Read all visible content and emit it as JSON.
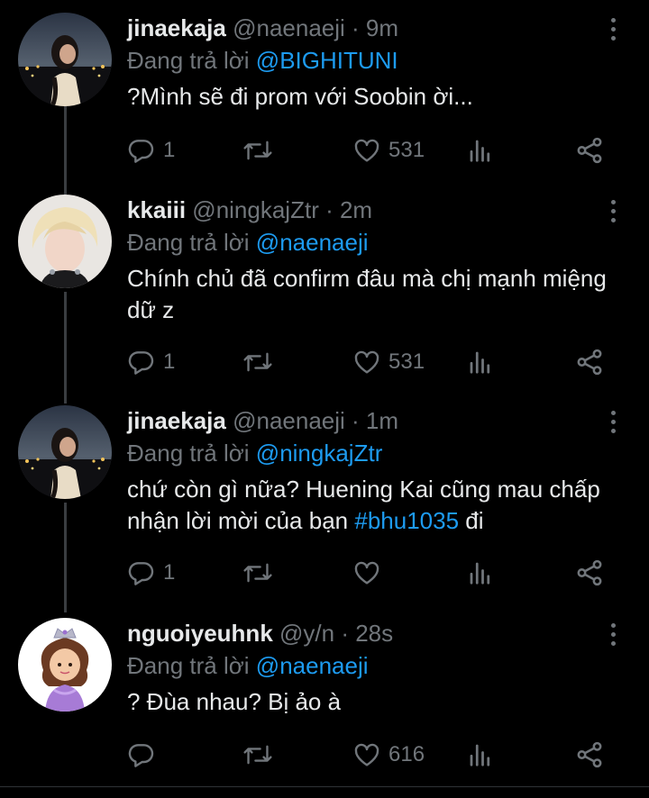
{
  "tweets": [
    {
      "name": "jinaekaja",
      "handle": "@naenaeji",
      "time": "· 9m",
      "reply_prefix": "Đang trả lời",
      "reply_to": "@BIGHITUNI",
      "text_parts": [
        "?Mình sẽ đi prom với Soobin ời...",
        "",
        ""
      ],
      "replies": "1",
      "likes": "531"
    },
    {
      "name": "kkaiii",
      "handle": "@ningkajZtr",
      "time": "· 2m",
      "reply_prefix": "Đang trả lời",
      "reply_to": "@naenaeji",
      "text_parts": [
        "Chính chủ đã confirm đâu mà chị mạnh miệng dữ z",
        "",
        ""
      ],
      "replies": "1",
      "likes": "531"
    },
    {
      "name": "jinaekaja",
      "handle": "@naenaeji",
      "time": "· 1m",
      "reply_prefix": "Đang trả lời",
      "reply_to": "@ningkajZtr",
      "text_parts": [
        "chứ còn gì nữa? Huening Kai cũng mau chấp nhận lời mời của bạn ",
        "#bhu1035",
        " đi"
      ],
      "replies": "1",
      "likes": ""
    },
    {
      "name": "nguoiyeuhnk",
      "handle": "@y/n",
      "time": "· 28s",
      "reply_prefix": "Đang trả lời",
      "reply_to": "@naenaeji",
      "text_parts": [
        "? Đùa nhau? Bị ảo à",
        "",
        ""
      ],
      "replies": "",
      "likes": "616"
    }
  ],
  "icons": {
    "reply": "reply-icon",
    "retweet": "retweet-icon",
    "like": "heart-icon",
    "views": "views-icon",
    "share": "share-icon",
    "more": "more-vertical-icon"
  },
  "colors": {
    "background": "#000000",
    "text": "#e7e9ea",
    "muted": "#71767b",
    "link": "#1d9bf0",
    "thread_line": "#3a3d41"
  }
}
